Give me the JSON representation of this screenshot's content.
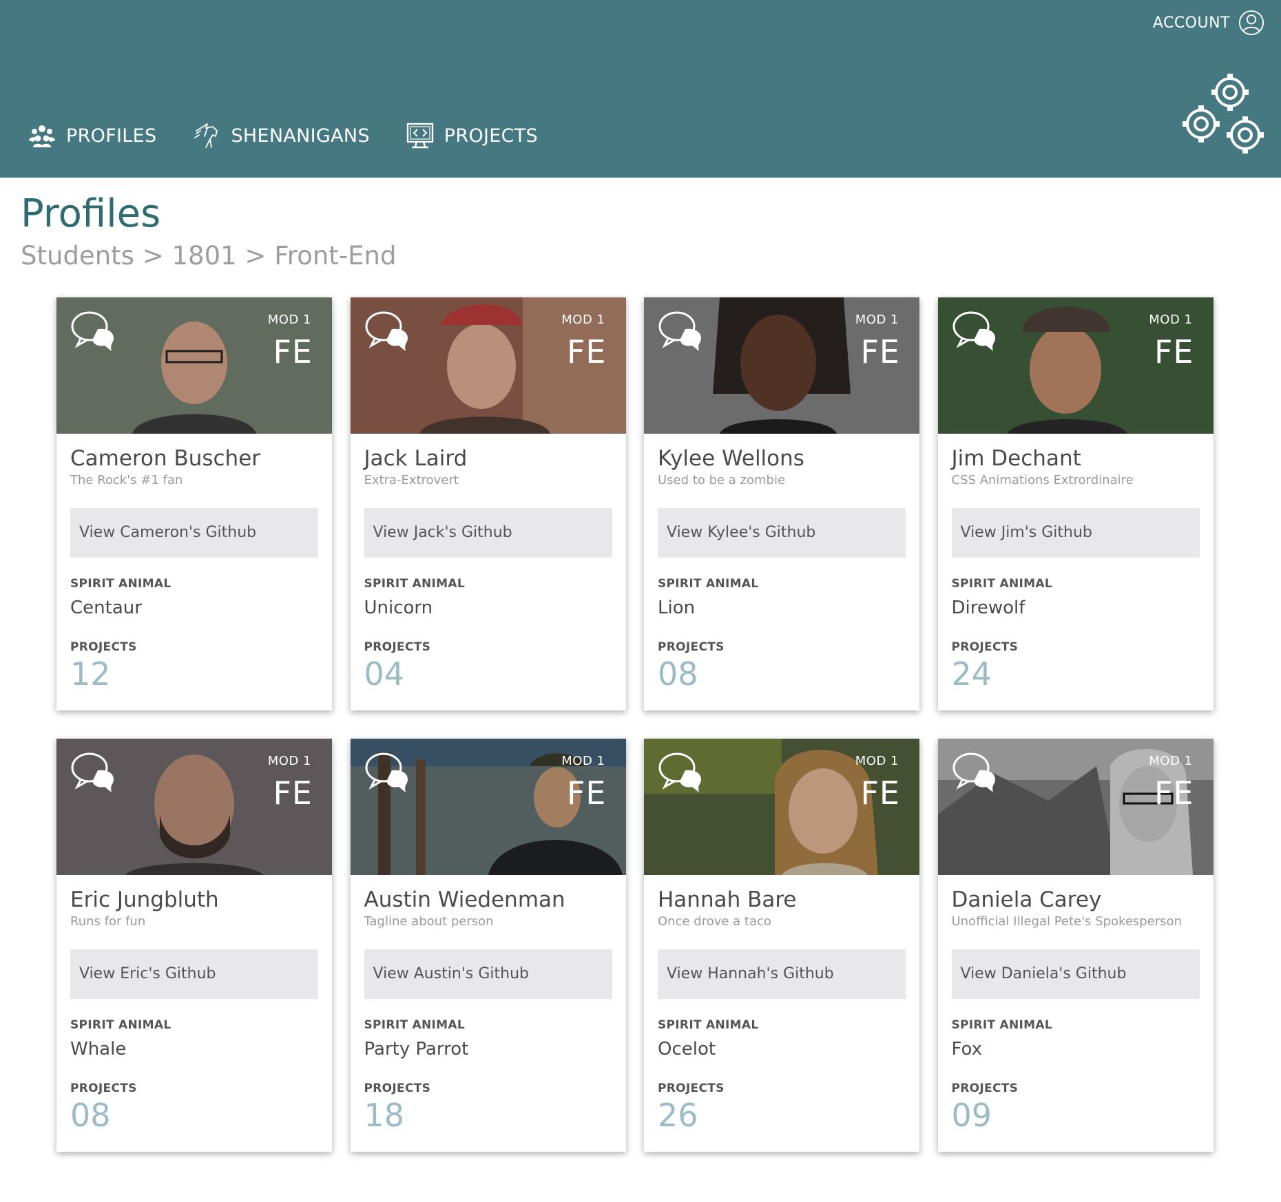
{
  "header": {
    "account_label": "ACCOUNT",
    "nav": [
      {
        "label": "PROFILES",
        "icon": "people-icon"
      },
      {
        "label": "SHENANIGANS",
        "icon": "unicorn-icon"
      },
      {
        "label": "PROJECTS",
        "icon": "code-monitor-icon"
      }
    ],
    "settings_icon": "gears-icon"
  },
  "page": {
    "title": "Profiles",
    "breadcrumb": [
      "Students",
      "1801",
      "Front-End"
    ],
    "breadcrumb_separator": ">"
  },
  "labels": {
    "spirit_animal": "SPIRIT ANIMAL",
    "projects": "PROJECTS"
  },
  "profiles": [
    {
      "mod": "MOD 1",
      "track": "FE",
      "name": "Cameron Buscher",
      "tagline": "The Rock's #1 fan",
      "github": "View Cameron's Github",
      "spirit_animal": "Centaur",
      "projects": "12",
      "bg": "#6f7a6b"
    },
    {
      "mod": "MOD 1",
      "track": "FE",
      "name": "Jack Laird",
      "tagline": "Extra-Extrovert",
      "github": "View Jack's Github",
      "spirit_animal": "Unicorn",
      "projects": "04",
      "bg": "#8a5a4a"
    },
    {
      "mod": "MOD 1",
      "track": "FE",
      "name": "Kylee Wellons",
      "tagline": "Used to be a zombie",
      "github": "View Kylee's Github",
      "spirit_animal": "Lion",
      "projects": "08",
      "bg": "#7b7b7b"
    },
    {
      "mod": "MOD 1",
      "track": "FE",
      "name": "Jim Dechant",
      "tagline": "CSS Animations Extrordinaire",
      "github": "View Jim's Github",
      "spirit_animal": "Direwolf",
      "projects": "24",
      "bg": "#3f5a3a"
    },
    {
      "mod": "MOD 1",
      "track": "FE",
      "name": "Eric Jungbluth",
      "tagline": "Runs for fun",
      "github": "View Eric's Github",
      "spirit_animal": "Whale",
      "projects": "08",
      "bg": "#6a6366"
    },
    {
      "mod": "MOD 1",
      "track": "FE",
      "name": "Austin Wiedenman",
      "tagline": "Tagline about person",
      "github": "View Austin's Github",
      "spirit_animal": "Party Parrot",
      "projects": "18",
      "bg": "#5e6c6a"
    },
    {
      "mod": "MOD 1",
      "track": "FE",
      "name": "Hannah Bare",
      "tagline": "Once drove a taco",
      "github": "View Hannah's Github",
      "spirit_animal": "Ocelot",
      "projects": "26",
      "bg": "#4f5a3a"
    },
    {
      "mod": "MOD 1",
      "track": "FE",
      "name": "Daniela Carey",
      "tagline": "Unofficial Illegal Pete's Spokesperson",
      "github": "View Daniela's Github",
      "spirit_animal": "Fox",
      "projects": "09",
      "bg": "#7a7a7a"
    }
  ]
}
